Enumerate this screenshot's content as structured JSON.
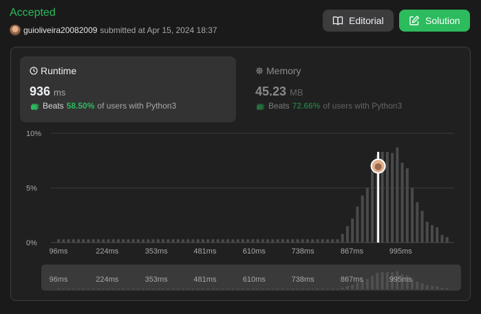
{
  "status": "Accepted",
  "submission": {
    "username": "guioliveira20082009",
    "text": "submitted at Apr 15, 2024 18:37"
  },
  "buttons": {
    "editorial": "Editorial",
    "solution": "Solution"
  },
  "runtime": {
    "label": "Runtime",
    "value": "936",
    "unit": "ms",
    "beats_prefix": "Beats",
    "beats_pct": "58.50%",
    "beats_suffix": "of users with Python3"
  },
  "memory": {
    "label": "Memory",
    "value": "45.23",
    "unit": "MB",
    "beats_prefix": "Beats",
    "beats_pct": "72.66%",
    "beats_suffix": "of users with Python3"
  },
  "colors": {
    "accent_green": "#2cbb5d",
    "bar": "#4a4a4a",
    "marker": "#ffffff"
  },
  "chart_data": {
    "type": "bar",
    "ylim": [
      0,
      10
    ],
    "yticks": [
      "0%",
      "5%",
      "10%"
    ],
    "xticks": [
      "96ms",
      "224ms",
      "353ms",
      "481ms",
      "610ms",
      "738ms",
      "867ms",
      "995ms"
    ],
    "x_range": [
      96,
      1117
    ],
    "grid": true,
    "marker_x": 936,
    "values": [
      0.3,
      0.3,
      0.3,
      0.3,
      0.3,
      0.3,
      0.3,
      0.3,
      0.3,
      0.3,
      0.3,
      0.3,
      0.3,
      0.3,
      0.3,
      0.3,
      0.3,
      0.3,
      0.3,
      0.3,
      0.3,
      0.3,
      0.3,
      0.3,
      0.3,
      0.3,
      0.3,
      0.3,
      0.3,
      0.3,
      0.3,
      0.3,
      0.3,
      0.3,
      0.3,
      0.3,
      0.3,
      0.3,
      0.3,
      0.3,
      0.3,
      0.3,
      0.3,
      0.3,
      0.3,
      0.3,
      0.3,
      0.3,
      0.3,
      0.3,
      0.3,
      0.3,
      0.3,
      0.3,
      0.3,
      0.3,
      0.3,
      0.8,
      1.5,
      2.2,
      3.3,
      4.3,
      5.0,
      6.5,
      8.0,
      8.3,
      8.3,
      8.2,
      8.7,
      7.3,
      6.8,
      5.0,
      3.7,
      2.9,
      1.9,
      1.6,
      1.4,
      0.7,
      0.5
    ]
  }
}
